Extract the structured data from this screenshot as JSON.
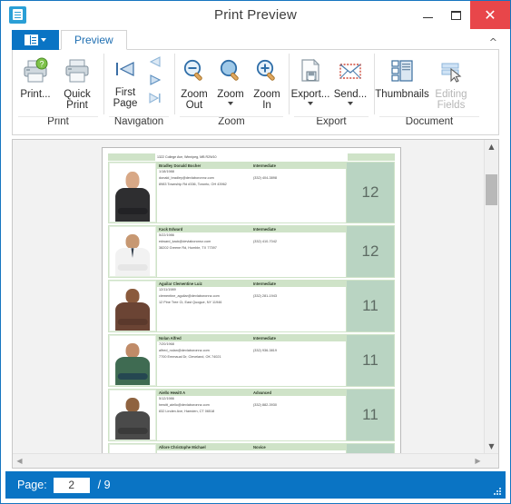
{
  "window": {
    "title": "Print Preview",
    "app_icon": "print-preview-icon",
    "minimize_label": "Minimize",
    "maximize_label": "Maximize",
    "close_label": "Close"
  },
  "ribbon": {
    "file_menu_label": "File Menu",
    "tabs": [
      {
        "label": "Preview",
        "active": true
      }
    ],
    "collapse_label": "^",
    "groups": [
      {
        "name": "Print",
        "label": "Print",
        "buttons": [
          {
            "name": "print",
            "label": "Print...",
            "icon": "printer-with-help-icon",
            "disabled": false
          },
          {
            "name": "quick-print",
            "label": "Quick\nPrint",
            "line1": "Quick",
            "line2": "Print",
            "icon": "printer-icon",
            "disabled": false
          }
        ]
      },
      {
        "name": "Navigation",
        "label": "Navigation",
        "buttons": [
          {
            "name": "first-page",
            "line1": "First",
            "line2": "Page",
            "label": "First Page",
            "icon": "first-page-icon",
            "disabled": false
          }
        ],
        "small_buttons": [
          {
            "name": "previous-page",
            "label": "Previous Page",
            "icon": "prev-page-icon",
            "disabled": true
          },
          {
            "name": "next-page",
            "label": "Next Page",
            "icon": "next-page-icon",
            "disabled": false
          },
          {
            "name": "last-page",
            "label": "Last Page",
            "icon": "last-page-icon",
            "disabled": false
          }
        ]
      },
      {
        "name": "Zoom",
        "label": "Zoom",
        "buttons": [
          {
            "name": "zoom-out",
            "line1": "Zoom",
            "line2": "Out",
            "label": "Zoom Out",
            "icon": "zoom-out-icon",
            "disabled": false
          },
          {
            "name": "zoom",
            "line1": "Zoom",
            "line2": "",
            "label": "Zoom",
            "icon": "zoom-icon",
            "disabled": false,
            "has_caret": true
          },
          {
            "name": "zoom-in",
            "line1": "Zoom",
            "line2": "In",
            "label": "Zoom In",
            "icon": "zoom-in-icon",
            "disabled": false
          }
        ]
      },
      {
        "name": "Export",
        "label": "Export",
        "buttons": [
          {
            "name": "export",
            "line1": "Export...",
            "line2": "",
            "label": "Export...",
            "icon": "export-document-icon",
            "disabled": false,
            "has_caret": true
          },
          {
            "name": "send",
            "line1": "Send...",
            "line2": "",
            "label": "Send...",
            "icon": "envelope-icon",
            "disabled": false,
            "has_caret": true
          }
        ]
      },
      {
        "name": "Document",
        "label": "Document",
        "buttons": [
          {
            "name": "thumbnails",
            "line1": "Thumbnails",
            "line2": "",
            "label": "Thumbnails",
            "icon": "thumbnails-icon",
            "disabled": false
          },
          {
            "name": "editing-fields",
            "line1": "Editing",
            "line2": "Fields",
            "label": "Editing Fields",
            "icon": "editing-fields-icon",
            "disabled": true
          }
        ]
      }
    ]
  },
  "preview": {
    "report": {
      "top_address": "1322 College Ave, Winnipeg, MB R2W10",
      "rows": [
        {
          "name": "Bradley Donald Bocher",
          "level": "Intermediate",
          "birthdate": "1/18/1988",
          "email": "donald_bradley@devlaboronnz.com",
          "phone": "(332) 404-3898",
          "address": "8983 Township Rd #336, Toronto, OH 43962",
          "count": "12",
          "photo": {
            "skin": "#d8a886",
            "shirt": "#2e2e30",
            "hair": "#6b4a32"
          }
        },
        {
          "name": "Kack Edward",
          "level": "Intermediate",
          "birthdate": "5/22/1986",
          "email": "edward_kack@devlaboronnz.com",
          "phone": "(332) 410-7042",
          "address": "38202 Greene Rd, Humble, TX 77397",
          "count": "12",
          "photo": {
            "skin": "#c79872",
            "shirt": "#f2f2f2",
            "hair": "#6d5a49"
          }
        },
        {
          "name": "Aguilar Clementine Luiz",
          "level": "Intermediate",
          "birthdate": "12/11/1989",
          "email": "clementine_aguilar@devlaboronnz.com",
          "phone": "(332) 281-1943",
          "address": "12 Pine Tree Ct, East Quogue, NY 11946",
          "count": "11",
          "photo": {
            "skin": "#8a5a3c",
            "shirt": "#6b4434",
            "hair": "#2a1a12"
          }
        },
        {
          "name": "Nolan Alfred",
          "level": "Intermediate",
          "birthdate": "7/20/1968",
          "email": "alfred_nolan@devlaboronnz.com",
          "phone": "(332) 936-3819",
          "address": "7700 Emmaual Dr, Cleveland, OK 74021",
          "count": "11",
          "photo": {
            "skin": "#c08b68",
            "shirt": "#3f6b52",
            "hair": "#cfcfcf"
          }
        },
        {
          "name": "Aiello Hewitt A",
          "level": "Advanced",
          "birthdate": "5/12/1986",
          "email": "hewitt_aiello@devlaboronnz.com",
          "phone": "(332) 882-3930",
          "address": "832 Linden Ave, Hamden, CT 06518",
          "count": "11",
          "photo": {
            "skin": "#8f6340",
            "shirt": "#4a4a4a",
            "hair": "#19120d"
          }
        }
      ],
      "partial_row": {
        "name": "Allore Christophe Michael",
        "level": "Novice"
      }
    },
    "vscroll_up": "scroll-up-icon",
    "vscroll_down": "scroll-down-icon",
    "hscroll_left": "scroll-left-icon",
    "hscroll_right": "scroll-right-icon"
  },
  "status": {
    "page_label": "Page:",
    "page_value": "2",
    "page_total": "/ 9"
  },
  "colors": {
    "accent": "#0a74c4",
    "close": "#e8464a",
    "report_header": "#cfe3c8",
    "report_count": "#b9d4c2",
    "tab_text": "#1f6fb2"
  }
}
